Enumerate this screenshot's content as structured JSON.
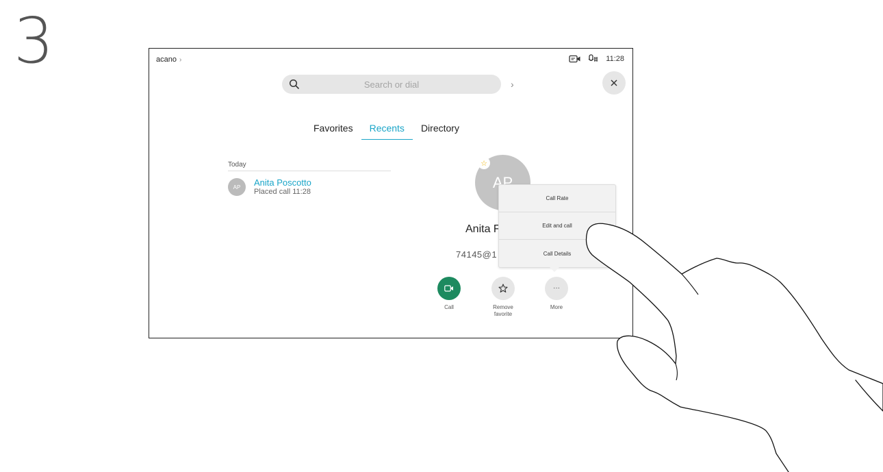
{
  "step": {
    "number": "3"
  },
  "header": {
    "breadcrumb": "acano",
    "clock": "11:28"
  },
  "search": {
    "placeholder": "Search or dial"
  },
  "tabs": [
    {
      "label": "Favorites",
      "active": false
    },
    {
      "label": "Recents",
      "active": true
    },
    {
      "label": "Directory",
      "active": false
    }
  ],
  "recents": {
    "section": "Today",
    "items": [
      {
        "initials": "AP",
        "name": "Anita Poscotto",
        "detail": "Placed call 11:28"
      }
    ]
  },
  "contact": {
    "initials": "AP",
    "name": "Anita F",
    "uri": "74145@1",
    "favorite": true
  },
  "actions": {
    "call": "Call",
    "remove_favorite_line1": "Remove",
    "remove_favorite_line2": "favorite",
    "more": "More",
    "more_glyph": "···"
  },
  "menu": {
    "items": [
      "Call Rate",
      "Edit and call",
      "Call Details"
    ]
  },
  "colors": {
    "accent": "#1aa5c8",
    "call_green": "#1d8a5f",
    "star": "#f0b400"
  }
}
